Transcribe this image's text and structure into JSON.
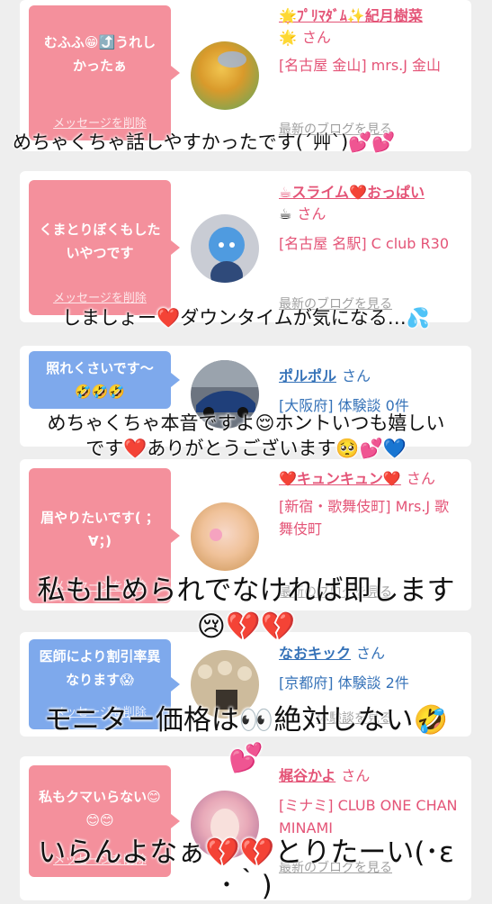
{
  "cards": [
    {
      "bubble_text": "むふふ😁⤴️うれしかったぁ",
      "delete_label": "メッセージを削除",
      "name": "🌟ﾌﾟﾘﾏﾀﾞﾑ✨紀月樹菜",
      "name_cont": "🌟",
      "honorific": "さん",
      "location": "[名古屋 金山] mrs.J 金山",
      "blog_link": "最新のブログを見る"
    },
    {
      "bubble_text": "くまとりぼくもしたいやつです",
      "delete_label": "メッセージを削除",
      "name": "☕スライム❤️おっぱい",
      "name_cont": "☕",
      "honorific": "さん",
      "location": "[名古屋 名駅] C club R30",
      "blog_link": "最新のブログを見る"
    },
    {
      "bubble_text": "照れくさいです〜🤣🤣🤣",
      "name": "ポルポル",
      "honorific": "さん",
      "location": "[大阪府] 体験談 0件"
    },
    {
      "bubble_text": "眉やりたいです( ；∀；)",
      "delete_label": "メッセージを削除",
      "name": "❤️キュンキュン❤️",
      "honorific": "さん",
      "location": "[新宿・歌舞伎町] Mrs.J 歌舞伎町",
      "blog_link": "最新のブログを見る"
    },
    {
      "bubble_text": "医師により割引率異なります😱",
      "delete_label": "メッセージを削除",
      "name": "なおキック",
      "honorific": "さん",
      "location": "[京都府] 体験談 2件",
      "blog_link": "体験談を見る"
    },
    {
      "bubble_text": "私もクマいらない😊😊😊",
      "delete_label": "メッセージを削除",
      "name": "梶谷かよ",
      "honorific": "さん",
      "location": "[ミナミ] CLUB ONE CHAN MINAMI",
      "blog_link": "最新のブログを見る"
    }
  ],
  "captions": {
    "c1": "めちゃくちゃ話しやすかったです(´艸`)💕💕",
    "c2": "しましょー❤️ダウンタイムが気になる…💦",
    "c3a": "めちゃくちゃ本音ですよ😌ホントいつも嬉しい",
    "c3b": "です❤️ありがとうございます🥺💕💙",
    "c4a": "私も止められでなければ即します",
    "c4b": "😢💔💔",
    "c5a": "モニター価格は👀絶対しない🤣",
    "c5b": "💕",
    "c6a": "いらんよなぁ💔💔とりたーい(･ε",
    "c6b": "･｀)"
  }
}
